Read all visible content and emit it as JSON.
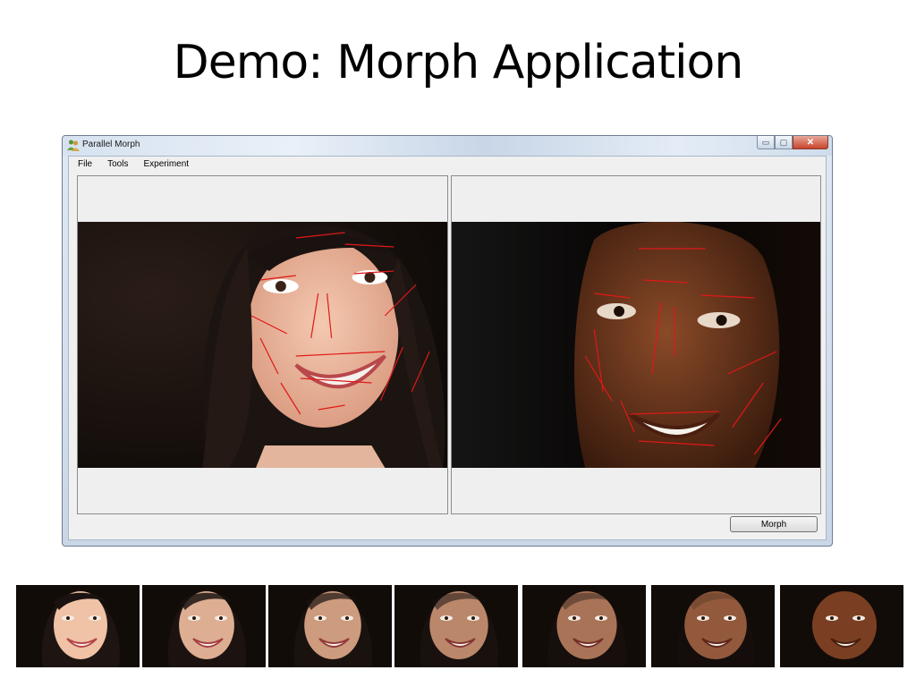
{
  "slide": {
    "title": "Demo: Morph Application"
  },
  "window": {
    "title": "Parallel Morph",
    "icon": "app-people-icon",
    "controls": [
      "minimize-icon",
      "maximize-icon",
      "close-icon"
    ]
  },
  "menu": {
    "items": [
      "File",
      "Tools",
      "Experiment"
    ]
  },
  "buttons": {
    "morph": "Morph"
  },
  "images": {
    "source": {
      "subject": "woman-face-with-feature-lines",
      "line_color": "#e01818"
    },
    "target": {
      "subject": "man-face-with-feature-lines",
      "line_color": "#e01818"
    }
  },
  "strip": {
    "frame_count": 7,
    "frames": [
      {
        "blend": 0.0
      },
      {
        "blend": 0.15
      },
      {
        "blend": 0.3
      },
      {
        "blend": 0.45
      },
      {
        "blend": 0.6
      },
      {
        "blend": 0.8
      },
      {
        "blend": 1.0
      }
    ]
  }
}
